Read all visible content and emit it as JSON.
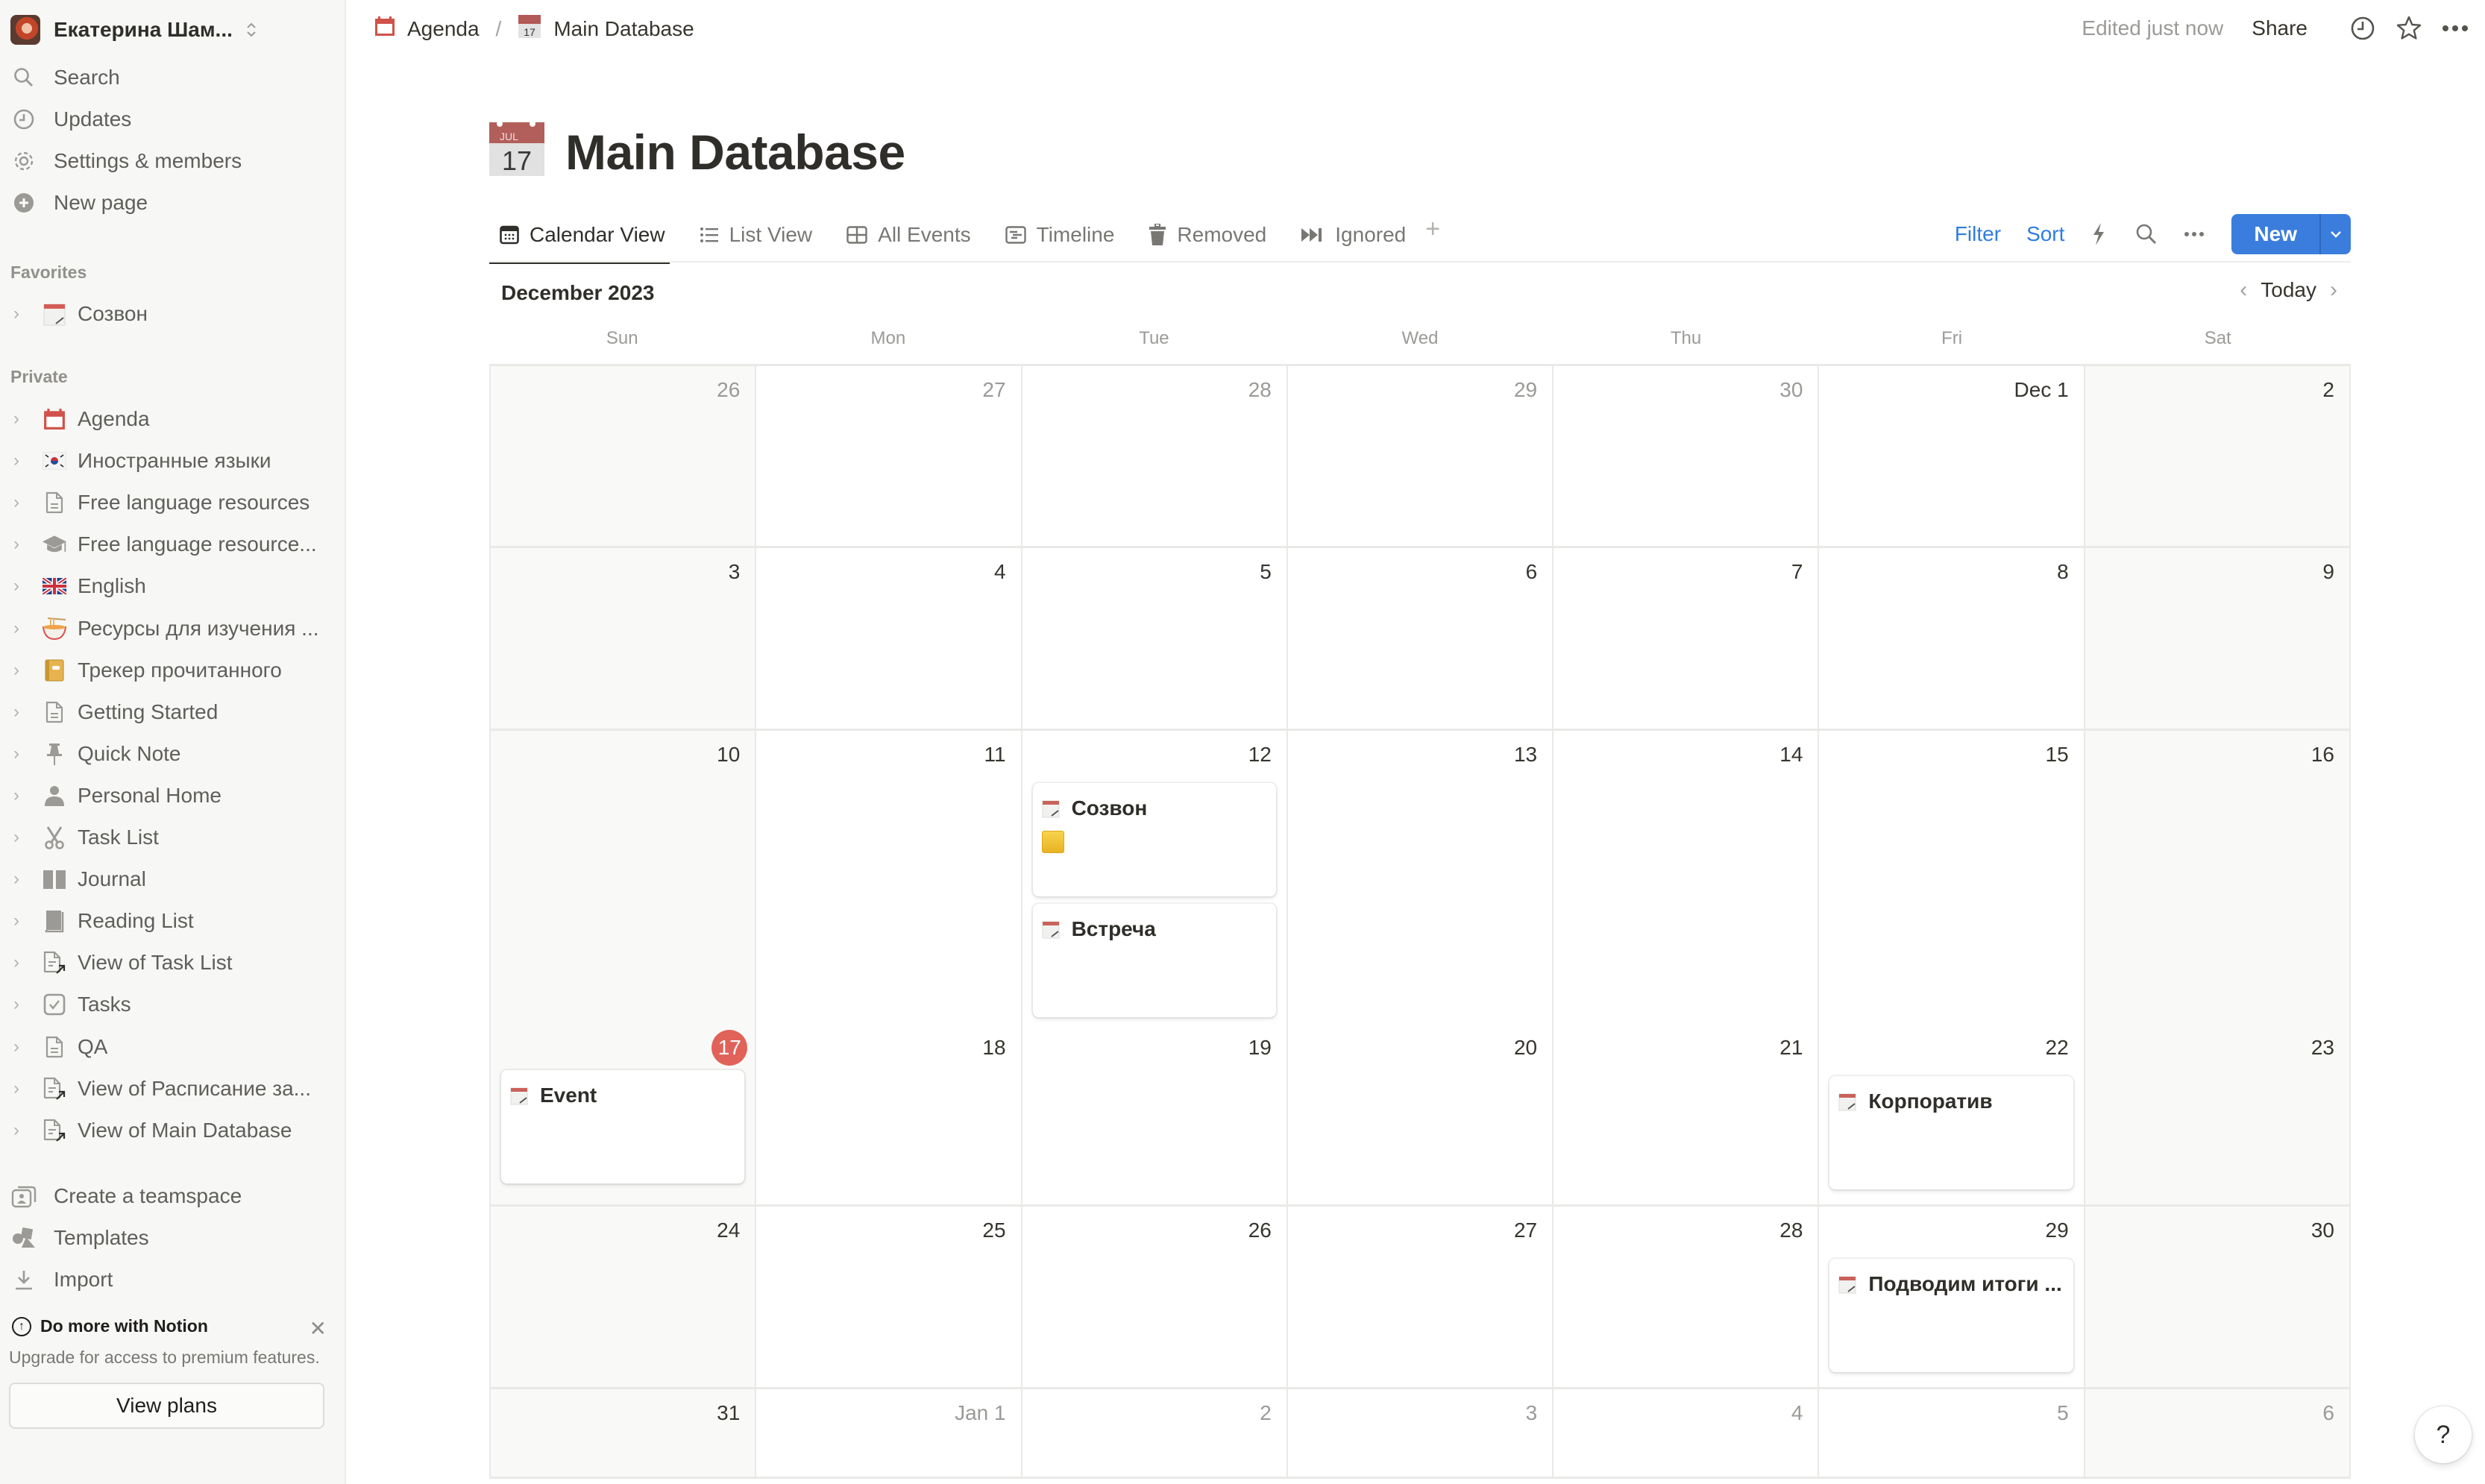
{
  "sidebar": {
    "workspace_name": "Екатерина Шам...",
    "nav": [
      {
        "label": "Search",
        "icon": "search-icon"
      },
      {
        "label": "Updates",
        "icon": "clock-icon"
      },
      {
        "label": "Settings & members",
        "icon": "gear-icon"
      },
      {
        "label": "New page",
        "icon": "plus-circle-icon"
      }
    ],
    "favorites_label": "Favorites",
    "favorites": [
      {
        "label": "Созвон",
        "icon": "spiral-calendar-icon"
      }
    ],
    "private_label": "Private",
    "private": [
      {
        "label": "Agenda",
        "icon": "calendar-icon"
      },
      {
        "label": "Иностранные языки",
        "icon": "korea-flag-icon"
      },
      {
        "label": "Free language resources",
        "icon": "page-icon"
      },
      {
        "label": "Free language resource...",
        "icon": "graduation-cap-icon"
      },
      {
        "label": "English",
        "icon": "uk-flag-icon"
      },
      {
        "label": "Ресурсы для изучения ...",
        "icon": "ramen-bowl-icon"
      },
      {
        "label": "Трекер прочитанного",
        "icon": "notebook-icon"
      },
      {
        "label": "Getting Started",
        "icon": "page-icon"
      },
      {
        "label": "Quick Note",
        "icon": "pin-icon"
      },
      {
        "label": "Personal Home",
        "icon": "person-icon"
      },
      {
        "label": "Task List",
        "icon": "scissors-icon"
      },
      {
        "label": "Journal",
        "icon": "open-book-icon"
      },
      {
        "label": "Reading List",
        "icon": "book-icon"
      },
      {
        "label": "View of Task List",
        "icon": "linked-page-icon"
      },
      {
        "label": "Tasks",
        "icon": "checkbox-icon"
      },
      {
        "label": "QA",
        "icon": "page-icon"
      },
      {
        "label": "View of Расписание за...",
        "icon": "linked-page-icon"
      },
      {
        "label": "View of Main Database",
        "icon": "linked-page-icon"
      }
    ],
    "bottom": [
      {
        "label": "Create a teamspace",
        "icon": "teamspace-icon"
      },
      {
        "label": "Templates",
        "icon": "shapes-icon"
      },
      {
        "label": "Import",
        "icon": "download-icon"
      }
    ],
    "upsell": {
      "title": "Do more with Notion",
      "text": "Upgrade for access to premium features.",
      "button": "View plans"
    }
  },
  "topbar": {
    "breadcrumbs": [
      {
        "label": "Agenda",
        "icon": "calendar-icon"
      },
      {
        "label": "Main Database",
        "icon": "tear-off-calendar-icon"
      }
    ],
    "separator": "/",
    "edited": "Edited just now",
    "share": "Share"
  },
  "page": {
    "title": "Main Database",
    "icon_month": "JUL",
    "icon_day": "17"
  },
  "tabs": [
    {
      "label": "Calendar View",
      "icon": "calendar-grid-icon",
      "active": true
    },
    {
      "label": "List View",
      "icon": "list-icon",
      "active": false
    },
    {
      "label": "All Events",
      "icon": "table-icon",
      "active": false
    },
    {
      "label": "Timeline",
      "icon": "timeline-icon",
      "active": false
    },
    {
      "label": "Removed",
      "icon": "trash-icon",
      "active": false
    },
    {
      "label": "Ignored",
      "icon": "fast-forward-icon",
      "active": false
    }
  ],
  "view_actions": {
    "filter": "Filter",
    "sort": "Sort",
    "new": "New"
  },
  "calendar": {
    "month_label": "December 2023",
    "today_label": "Today",
    "weekdays": [
      "Sun",
      "Mon",
      "Tue",
      "Wed",
      "Thu",
      "Fri",
      "Sat"
    ],
    "accent_today": "#e16259",
    "weeks": [
      [
        {
          "label": "26",
          "muted": true
        },
        {
          "label": "27",
          "muted": true
        },
        {
          "label": "28",
          "muted": true
        },
        {
          "label": "29",
          "muted": true
        },
        {
          "label": "30",
          "muted": true
        },
        {
          "label": "Dec 1"
        },
        {
          "label": "2"
        }
      ],
      [
        {
          "label": "3"
        },
        {
          "label": "4"
        },
        {
          "label": "5"
        },
        {
          "label": "6"
        },
        {
          "label": "7"
        },
        {
          "label": "8"
        },
        {
          "label": "9"
        }
      ],
      [
        {
          "label": "10"
        },
        {
          "label": "11"
        },
        {
          "label": "12",
          "events": [
            {
              "title": "Созвон",
              "has_property_swatch": true
            },
            {
              "title": "Встреча"
            }
          ]
        },
        {
          "label": "13"
        },
        {
          "label": "14"
        },
        {
          "label": "15"
        },
        {
          "label": "16"
        }
      ],
      [
        {
          "label": "17",
          "today": true,
          "events": [
            {
              "title": "Event"
            }
          ]
        },
        {
          "label": "18"
        },
        {
          "label": "19"
        },
        {
          "label": "20"
        },
        {
          "label": "21"
        },
        {
          "label": "22",
          "events": [
            {
              "title": "Корпоратив"
            }
          ]
        },
        {
          "label": "23"
        }
      ],
      [
        {
          "label": "24"
        },
        {
          "label": "25"
        },
        {
          "label": "26"
        },
        {
          "label": "27"
        },
        {
          "label": "28"
        },
        {
          "label": "29",
          "events": [
            {
              "title": "Подводим итоги ..."
            }
          ]
        },
        {
          "label": "30"
        }
      ],
      [
        {
          "label": "31"
        },
        {
          "label": "Jan 1",
          "muted": true
        },
        {
          "label": "2",
          "muted": true
        },
        {
          "label": "3",
          "muted": true
        },
        {
          "label": "4",
          "muted": true
        },
        {
          "label": "5",
          "muted": true
        },
        {
          "label": "6",
          "muted": true
        }
      ]
    ]
  },
  "help": "?"
}
